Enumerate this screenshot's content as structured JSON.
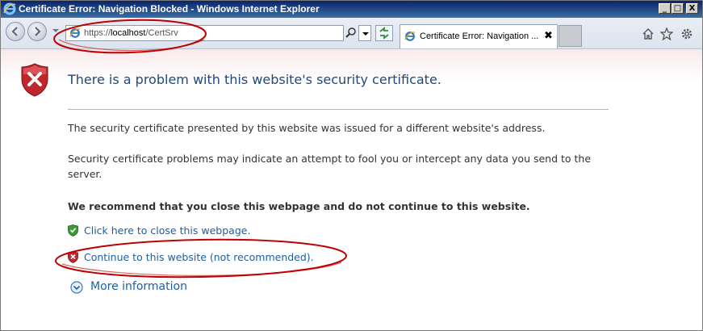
{
  "window": {
    "title": "Certificate Error: Navigation Blocked - Windows Internet Explorer",
    "controls": {
      "minimize": "_",
      "maximize": "□",
      "close": "X"
    }
  },
  "toolbar": {
    "address": {
      "prefix": "https://",
      "host": "localhost",
      "path": "/CertSrv"
    },
    "icons": [
      "back-icon",
      "forward-icon",
      "search-icon",
      "refresh-icon",
      "home-icon",
      "favorites-star-icon",
      "tools-gear-icon"
    ]
  },
  "tab": {
    "label": "Certificate Error: Navigation ...",
    "close": "✖"
  },
  "page": {
    "headline": "There is a problem with this website's security certificate.",
    "para1": "The security certificate presented by this website was issued for a different website's address.",
    "para2_line1": "Security certificate problems may indicate an attempt to fool you or intercept any data you send to the",
    "para2_line2": "server.",
    "recommend": "We recommend that you close this webpage and do not continue to this website.",
    "close_link": "Click here to close this webpage.",
    "continue_link": "Continue to this website (not recommended).",
    "more_info": "More information"
  },
  "colors": {
    "link": "#1f5fa0",
    "headline": "#1f497d",
    "annotation": "#c00000",
    "error_shield": "#c0272d",
    "ok_shield": "#3a9a3a"
  }
}
